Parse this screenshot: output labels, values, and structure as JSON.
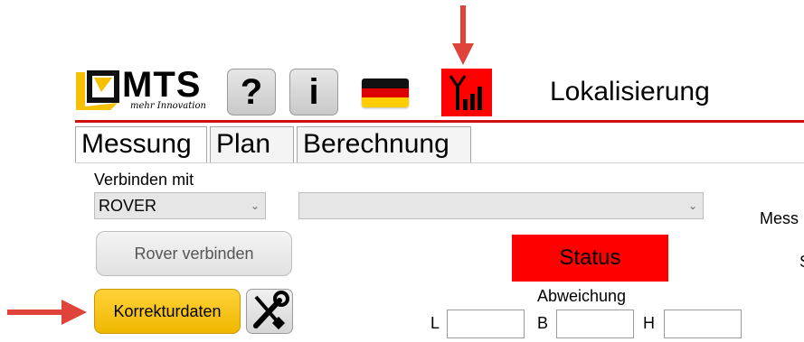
{
  "header": {
    "logo_text": "MTS",
    "logo_subtitle": "mehr Innovation",
    "help_label": "?",
    "info_label": "i",
    "language_icon": "german-flag-icon",
    "signal_icon": "signal-antenna-icon",
    "screen_title": "Lokalisierung"
  },
  "tabs": [
    {
      "label": "Messung"
    },
    {
      "label": "Plan"
    },
    {
      "label": "Berechnung"
    }
  ],
  "connect": {
    "label": "Verbinden mit",
    "device_value": "ROVER",
    "second_value": ""
  },
  "right_cut_labels": {
    "mess": "Mess",
    "s": "S"
  },
  "buttons": {
    "rover_connect": "Rover verbinden",
    "correction_data": "Korrekturdaten",
    "tools_icon": "tools-icon"
  },
  "status": {
    "label": "Status",
    "color": "#ff0000"
  },
  "deviation": {
    "label": "Abweichung",
    "fields": [
      {
        "label": "L",
        "value": ""
      },
      {
        "label": "B",
        "value": ""
      },
      {
        "label": "H",
        "value": ""
      }
    ]
  },
  "colors": {
    "accent_red": "#d01010",
    "arrow": "#e0433a",
    "korr_button": "#f5c000"
  }
}
